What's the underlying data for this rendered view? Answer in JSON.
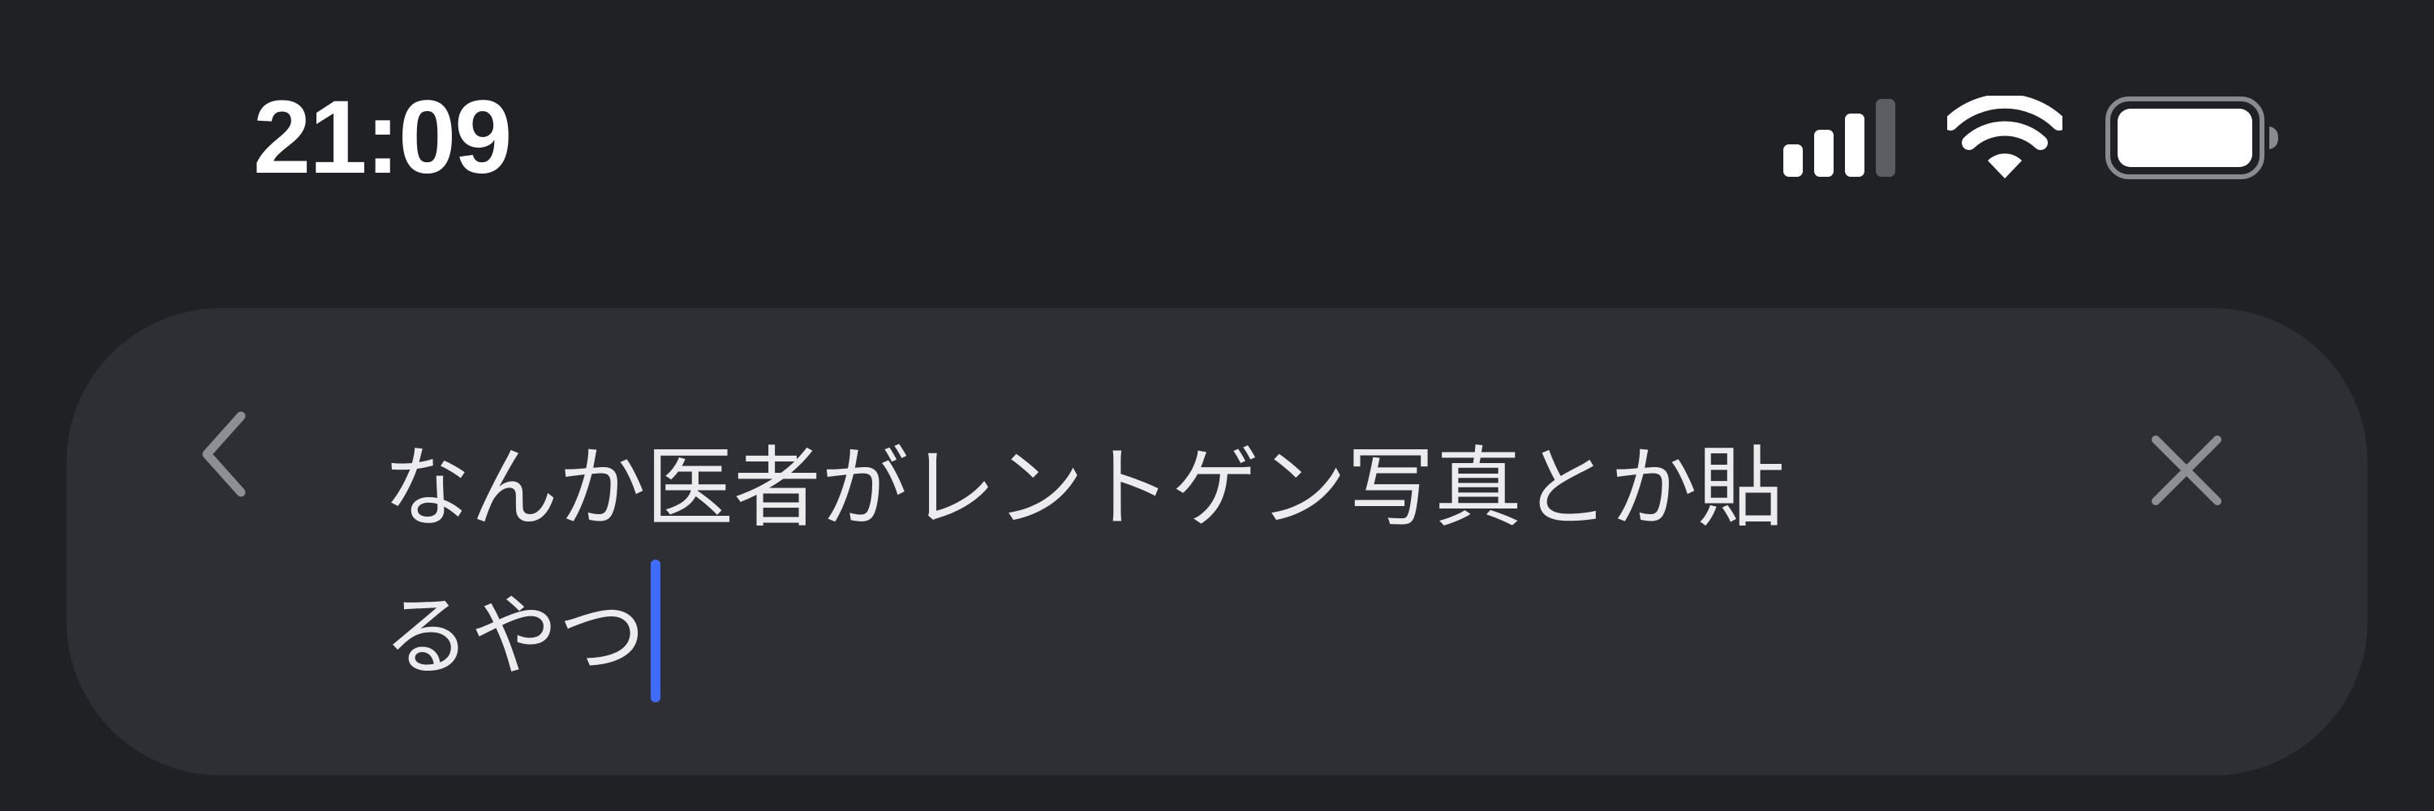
{
  "status_bar": {
    "time": "21:09",
    "signal_level": 3,
    "signal_max": 4,
    "icons": [
      "cellular-signal-icon",
      "wifi-icon",
      "battery-icon"
    ]
  },
  "search": {
    "text_line1": "なんか医者がレントゲン写真とか貼",
    "text_line2": "るやつ",
    "back_icon": "chevron-left-icon",
    "clear_icon": "close-icon"
  },
  "colors": {
    "background": "#202124",
    "field": "#2e2f34",
    "text": "#ececee",
    "icon": "#8e8f94",
    "caret": "#3f6bff"
  }
}
